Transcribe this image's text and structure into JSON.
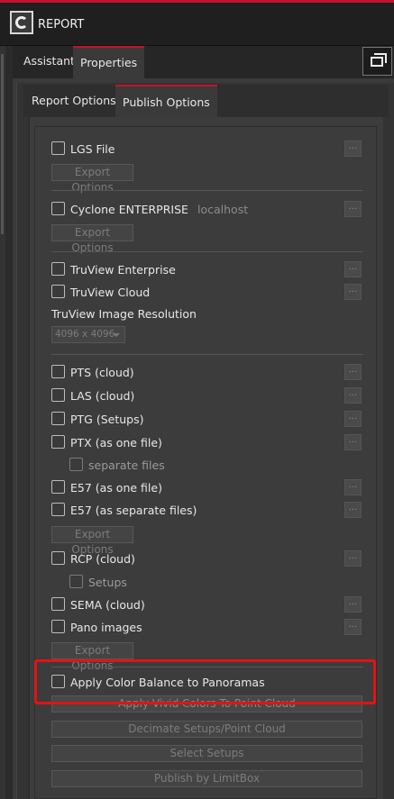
{
  "app": {
    "title": "REPORT"
  },
  "top_tabs": [
    {
      "label": "Assistant"
    },
    {
      "label": "Properties",
      "active": true
    }
  ],
  "sub_tabs": [
    {
      "label": "Report Options"
    },
    {
      "label": "Publish Options",
      "active": true
    }
  ],
  "options": {
    "lgs_file": {
      "label": "LGS File",
      "export_button": "Export Options",
      "more": "..."
    },
    "cyclone": {
      "label": "Cyclone ENTERPRISE",
      "server": "localhost",
      "export_button": "Export Options",
      "more": "..."
    },
    "truview_enterprise": {
      "label": "TruView Enterprise",
      "more": "..."
    },
    "truview_cloud": {
      "label": "TruView Cloud",
      "more": "..."
    },
    "truview_resolution": {
      "label": "TruView Image Resolution",
      "value": "4096 x 4096"
    },
    "pts": {
      "label": "PTS (cloud)",
      "more": "..."
    },
    "las": {
      "label": "LAS (cloud)",
      "more": "..."
    },
    "ptg": {
      "label": "PTG (Setups)",
      "more": "..."
    },
    "ptx": {
      "label": "PTX (as one file)",
      "more": "..."
    },
    "ptx_separate": {
      "label": "separate files"
    },
    "e57_one": {
      "label": "E57 (as one file)",
      "more": "..."
    },
    "e57_separate": {
      "label": "E57 (as separate files)",
      "more": "..."
    },
    "e57_export_button": "Export Options",
    "rcp": {
      "label": "RCP (cloud)",
      "more": "..."
    },
    "rcp_setups": {
      "label": "Setups"
    },
    "sema": {
      "label": "SEMA (cloud)",
      "more": "..."
    },
    "pano": {
      "label": "Pano images",
      "more": "..."
    },
    "pano_export_button": "Export Options",
    "apply_color_balance": {
      "label": "Apply Color Balance to Panoramas"
    }
  },
  "actions": {
    "vivid_colors": "Apply Vivid Colors To Point Cloud",
    "decimate": "Decimate Setups/Point Cloud",
    "select_setups": "Select Setups",
    "publish_limitbox": "Publish by LimitBox"
  },
  "colors": {
    "accent": "#c8102e",
    "highlight": "#e11414"
  }
}
